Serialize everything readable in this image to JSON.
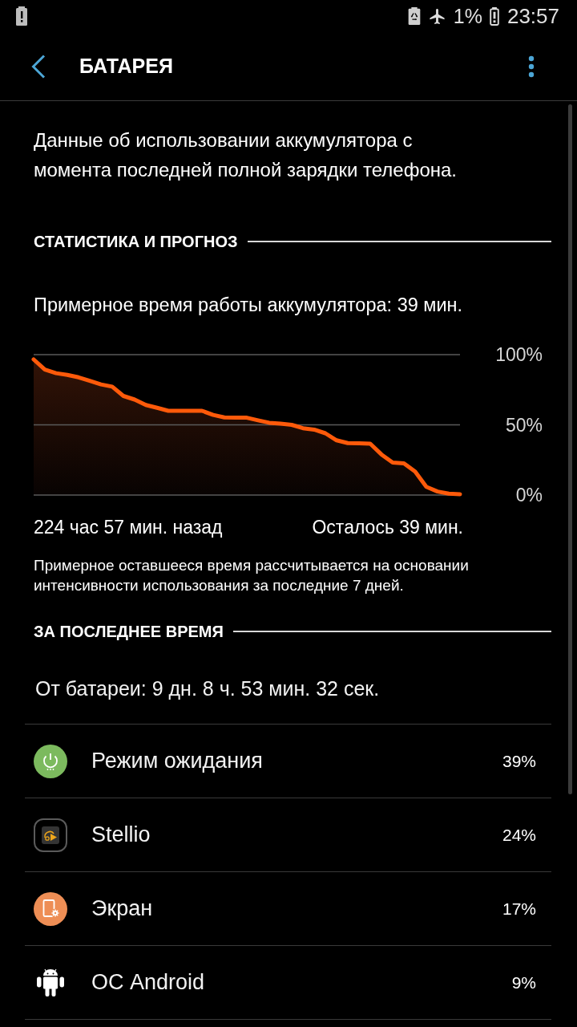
{
  "status_bar": {
    "battery_percent": "1%",
    "time": "23:57"
  },
  "header": {
    "title": "БАТАРЕЯ"
  },
  "intro": "Данные об использовании аккумулятора с момента последней полной зарядки телефона.",
  "stats": {
    "heading": "СТАТИСТИКА И ПРОГНОЗ",
    "estimate": "Примерное время работы аккумулятора: 39 мин.",
    "chart_data": {
      "type": "area",
      "ylim": [
        0,
        100
      ],
      "yticks": [
        {
          "value": 100,
          "label": "100%"
        },
        {
          "value": 50,
          "label": "50%"
        },
        {
          "value": 0,
          "label": "0%"
        }
      ],
      "values": [
        96.6,
        89.3,
        86.8,
        85.6,
        83.8,
        81.3,
        78.8,
        77.2,
        70.6,
        68,
        64.1,
        62.1,
        60,
        60,
        60,
        60,
        57.1,
        55.3,
        55.2,
        55.1,
        53.2,
        51.5,
        50.8,
        50,
        47.6,
        46.6,
        44,
        39,
        37,
        36.8,
        36.6,
        28.9,
        23.1,
        22.6,
        16.7,
        5.8,
        2.5,
        1,
        0.6
      ]
    },
    "start_label": "224 час 57 мин. назад",
    "end_label": "Осталось 39 мин.",
    "note": "Примерное оставшееся время рассчитывается на основании интенсивности использования за последние 7 дней."
  },
  "recent": {
    "heading": "ЗА ПОСЛЕДНЕЕ ВРЕМЯ",
    "on_battery": "От батареи: 9 дн. 8 ч. 53 мин. 32 сек.",
    "items": [
      {
        "kind": "standby",
        "name": "Режим ожидания",
        "percent": "39%"
      },
      {
        "kind": "app",
        "name": "Stellio",
        "percent": "24%"
      },
      {
        "kind": "screen",
        "name": "Экран",
        "percent": "17%"
      },
      {
        "kind": "system",
        "name": "ОС Android",
        "percent": "9%"
      }
    ]
  }
}
